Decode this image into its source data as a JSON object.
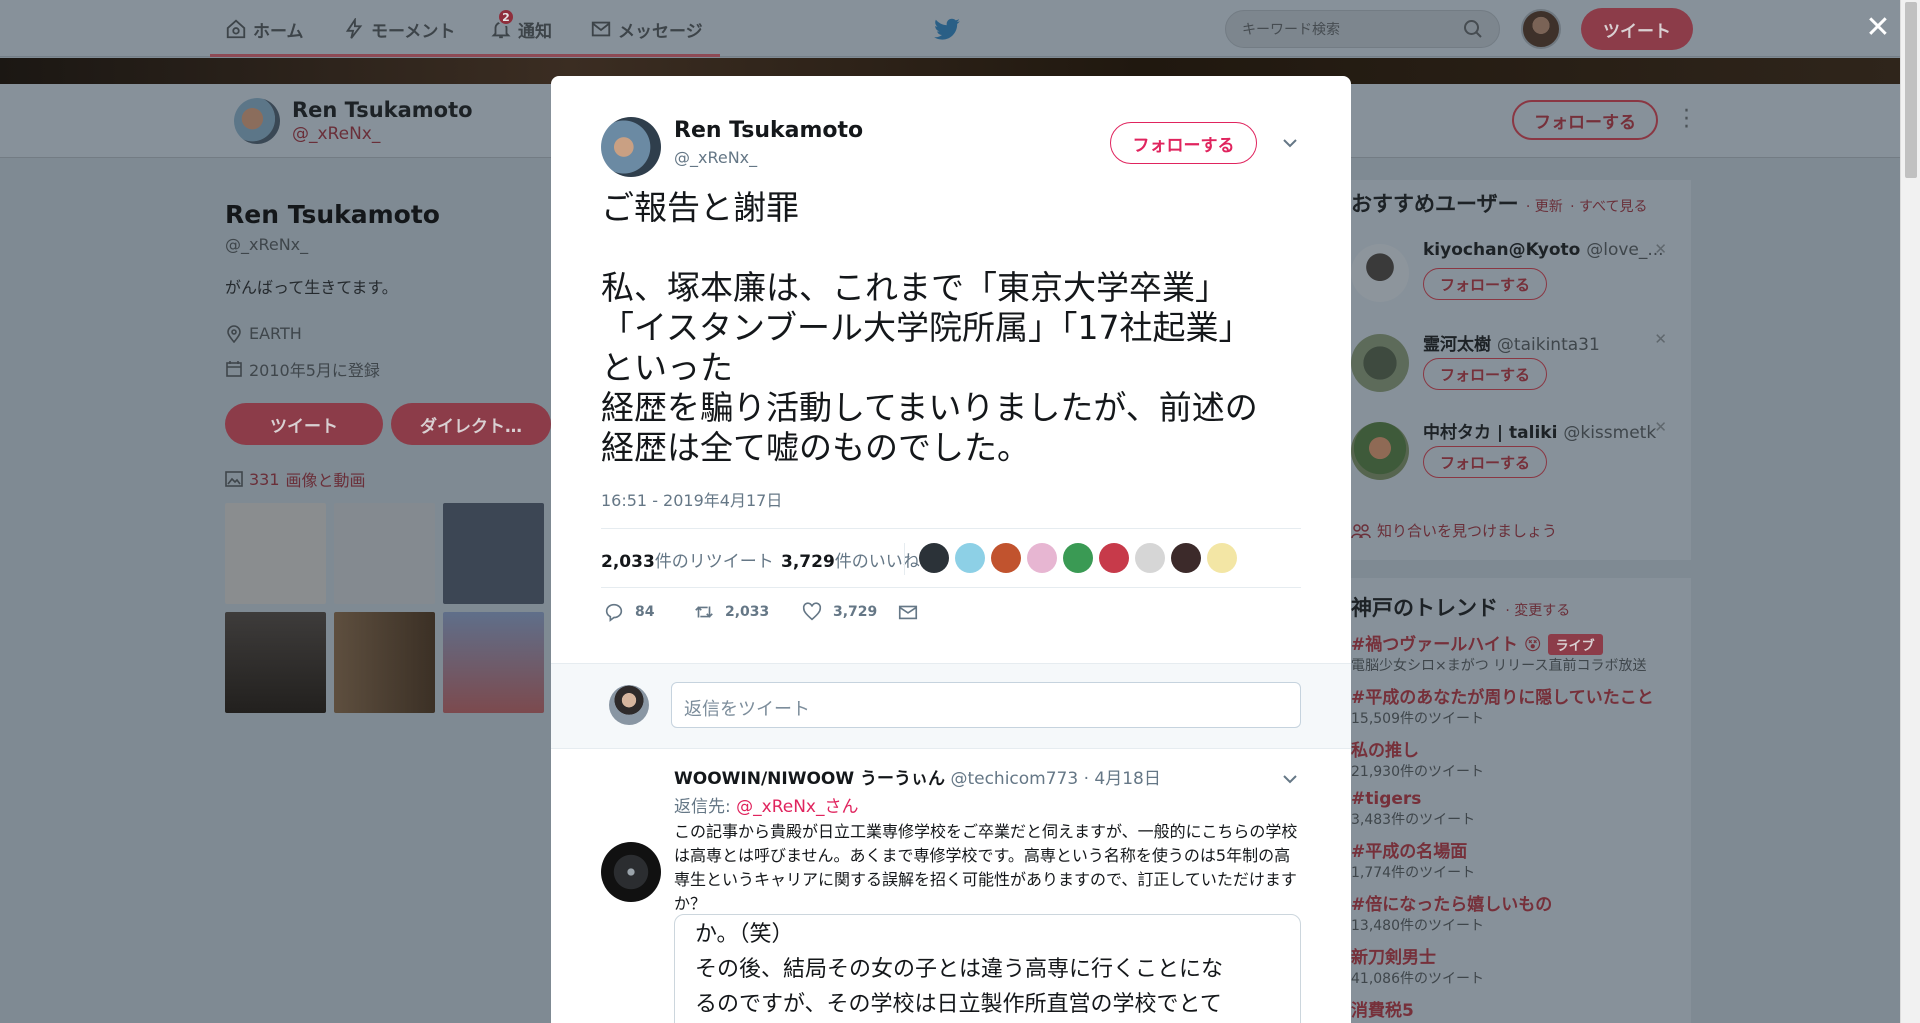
{
  "nav": {
    "home": "ホーム",
    "moments": "モーメント",
    "notifications": "通知",
    "notification_count": "2",
    "messages": "メッセージ",
    "search_placeholder": "キーワード検索",
    "tweet_button": "ツイート"
  },
  "profile": {
    "name": "Ren Tsukamoto",
    "handle": "@_xReNx_",
    "follow_button": "フォローする",
    "bio": "がんばって生きてます。",
    "location": "EARTH",
    "joined": "2010年5月に登録",
    "tweet_button": "ツイート",
    "dm_button": "ダイレクト…",
    "media_count": "331",
    "media_label": "画像と動画"
  },
  "tweet": {
    "name": "Ren Tsukamoto",
    "handle": "@_xReNx_",
    "follow_button": "フォローする",
    "text": "ご報告と謝罪\n\n私、塚本廉は、これまで「東京大学卒業」\n「イスタンブール大学院所属」「17社起業」\nといった\n経歴を騙り活動してまいりましたが、前述の\n経歴は全て嘘のものでした。",
    "timestamp": "16:51 - 2019年4月17日",
    "retweets_count": "2,033",
    "retweets_label": "件のリツイート",
    "likes_count": "3,729",
    "likes_label": "件のいいね",
    "action_replies": "84",
    "action_retweets": "2,033",
    "action_likes": "3,729"
  },
  "reply_box": {
    "placeholder": "返信をツイート"
  },
  "reply": {
    "name": "WOOWIN/NIWOOW うーうぃん",
    "handle": "@techicom773",
    "date": "· 4月18日",
    "reply_to_label": "返信先:",
    "reply_to_handle": "@_xReNx_",
    "reply_to_suffix": "さん",
    "text": "この記事から貴殿が日立工業専修学校をご卒業だと伺えますが、一般的にこちらの学校は高専とは呼びません。あくまで専修学校です。高専という名称を使うのは5年制の高専生というキャリアに関する誤解を招く可能性がありますので、訂正していただけますか？",
    "quote_text": "か。（笑）\nその後、結局その女の子とは違う高専に行くことにな\nるのですが、その学校は日立製作所直営の学校でとて"
  },
  "recommended": {
    "title": "おすすめユーザー",
    "refresh": "· 更新",
    "see_all": "· すべて見る",
    "users": [
      {
        "name": "kiyochan@Kyoto",
        "handle": "@love_...",
        "follow": "フォローする"
      },
      {
        "name": "霊河太樹",
        "handle": "@taikinta31",
        "follow": "フォローする"
      },
      {
        "name": "中村タカ | taliki",
        "handle": "@kissmetk",
        "follow": "フォローする"
      }
    ],
    "find_friends": "知り合いを見つけましょう"
  },
  "trends": {
    "title": "神戸のトレンド",
    "change": "· 変更する",
    "items": [
      {
        "name": "#禍つヴァールハイト",
        "sub": "電脳少女シロ×まがつ リリース直前コラボ放送",
        "badge": "ライブ"
      },
      {
        "name": "#平成のあなたが周りに隠していたこと",
        "sub": "15,509件のツイート"
      },
      {
        "name": "私の推し",
        "sub": "21,930件のツイート"
      },
      {
        "name": "#tigers",
        "sub": "3,483件のツイート"
      },
      {
        "name": "#平成の名場面",
        "sub": "1,774件のツイート"
      },
      {
        "name": "#倍になったら嬉しいもの",
        "sub": "13,480件のツイート"
      },
      {
        "name": "新刀剣男士",
        "sub": "41,086件のツイート"
      },
      {
        "name": "消費税5",
        "sub": ""
      }
    ]
  },
  "colors": {
    "accent": "#e0245e",
    "brand": "#1da1f2",
    "overlay": "#7f8a93"
  }
}
